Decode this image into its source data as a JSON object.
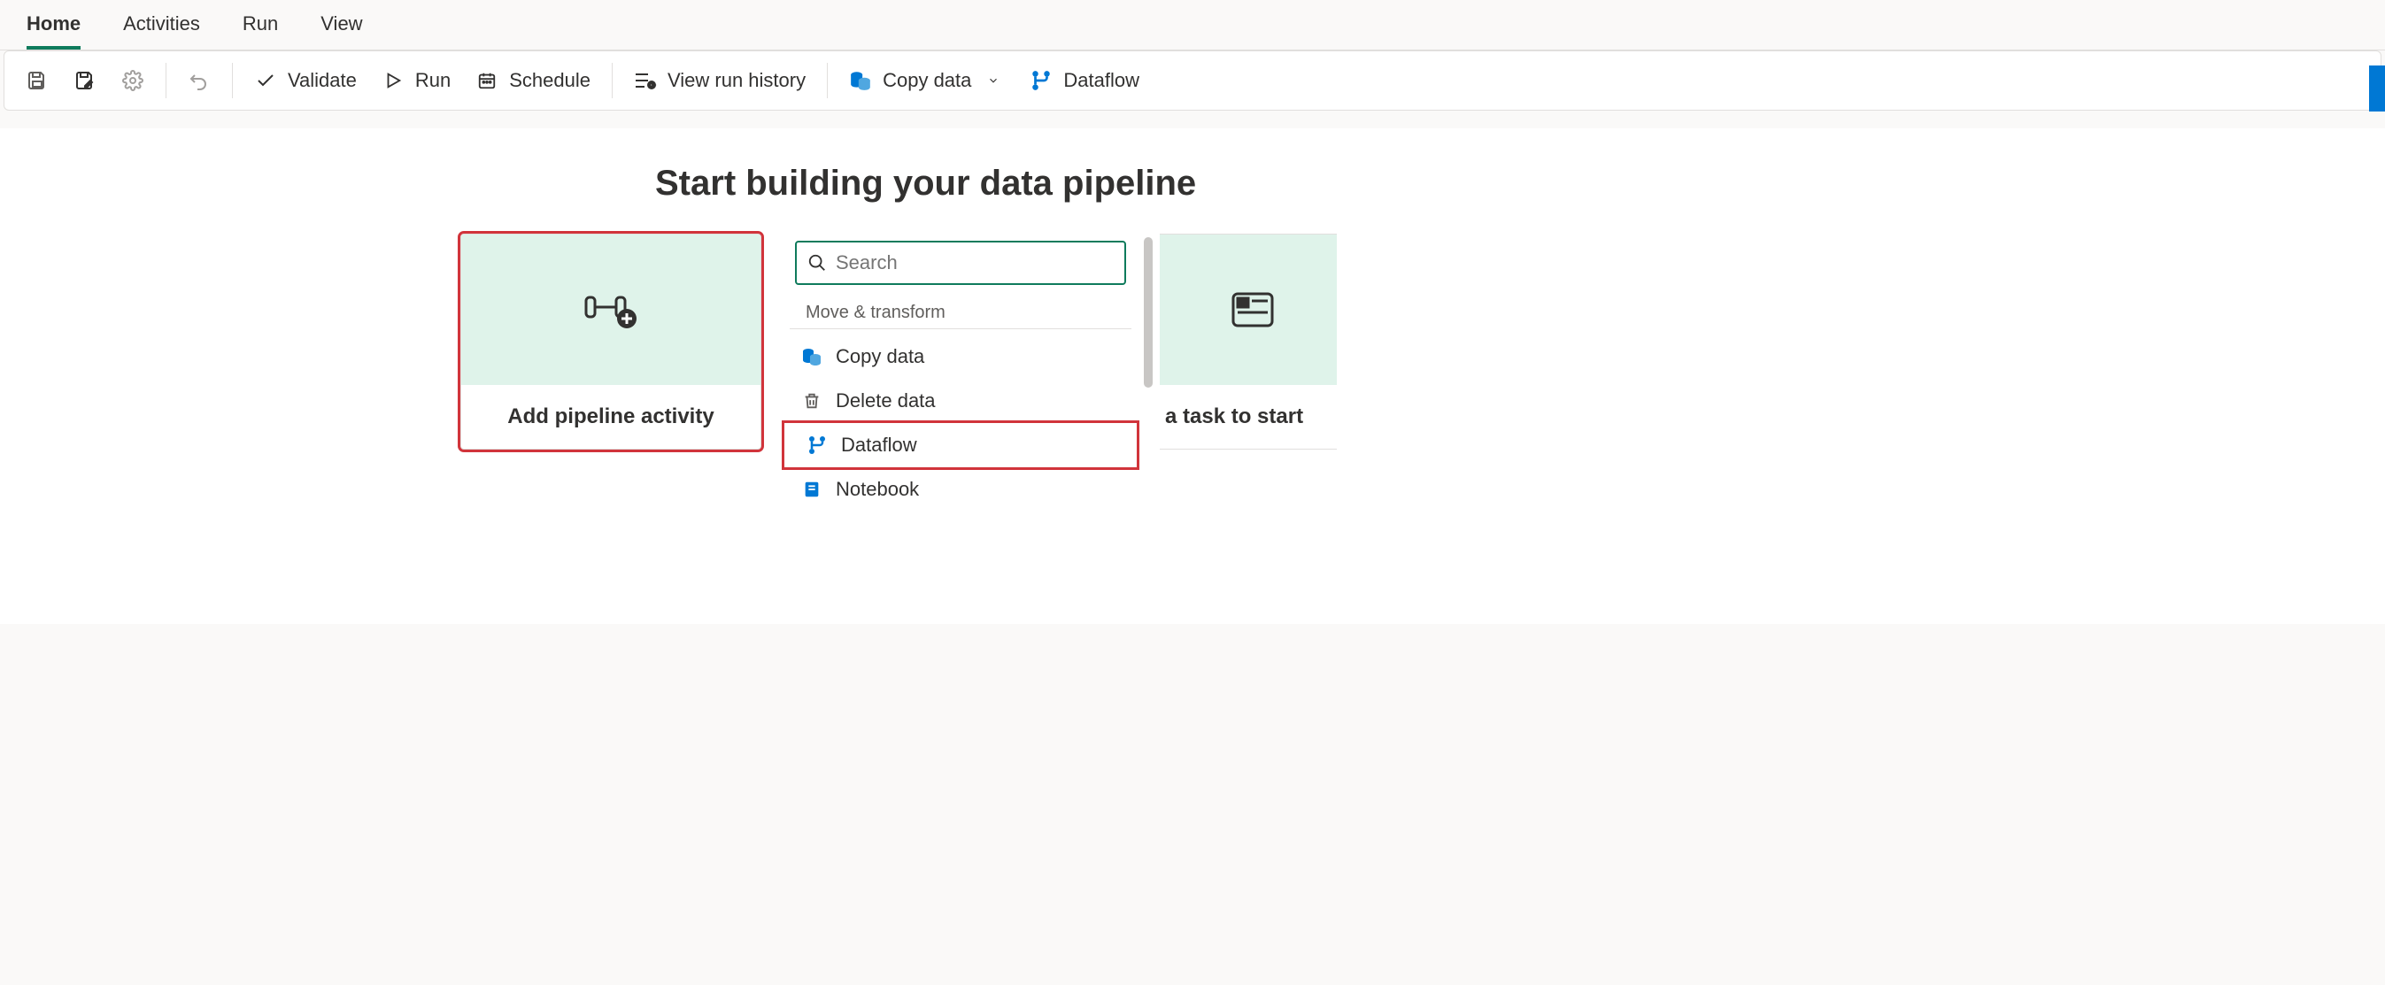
{
  "tabs": {
    "home": "Home",
    "activities": "Activities",
    "run": "Run",
    "view": "View"
  },
  "toolbar": {
    "validate": "Validate",
    "run": "Run",
    "schedule": "Schedule",
    "view_run_history": "View run history",
    "copy_data": "Copy data",
    "dataflow": "Dataflow"
  },
  "page": {
    "heading": "Start building your data pipeline"
  },
  "card": {
    "add_activity": "Add pipeline activity"
  },
  "search": {
    "placeholder": "Search"
  },
  "menu": {
    "section": "Move & transform",
    "copy_data": "Copy data",
    "delete_data": "Delete data",
    "dataflow": "Dataflow",
    "notebook": "Notebook"
  },
  "right_card": {
    "label": "a task to start"
  }
}
